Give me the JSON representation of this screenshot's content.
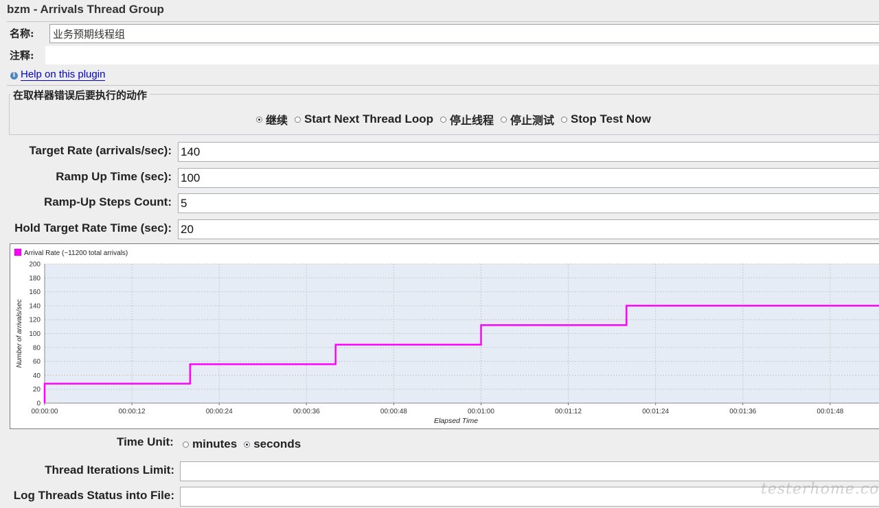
{
  "window": {
    "title": "bzm - Arrivals Thread Group"
  },
  "name_field": {
    "label": "名称:",
    "value": "业务预期线程组"
  },
  "comment_field": {
    "label": "注释:",
    "value": ""
  },
  "help": {
    "label": "Help on this plugin",
    "icon": "info-icon"
  },
  "sampler_error": {
    "title": "在取样器错误后要执行的动作",
    "options": [
      {
        "label": "继续",
        "checked": true
      },
      {
        "label": "Start Next Thread Loop",
        "checked": false
      },
      {
        "label": "停止线程",
        "checked": false
      },
      {
        "label": "停止测试",
        "checked": false
      },
      {
        "label": "Stop Test Now",
        "checked": false
      }
    ]
  },
  "params": {
    "target_rate": {
      "label": "Target Rate (arrivals/sec):",
      "value": "140"
    },
    "ramp_up_time": {
      "label": "Ramp Up Time (sec):",
      "value": "100"
    },
    "ramp_up_steps": {
      "label": "Ramp-Up Steps Count:",
      "value": "5"
    },
    "hold_time": {
      "label": "Hold Target Rate Time (sec):",
      "value": "20"
    }
  },
  "time_unit": {
    "label": "Time Unit:",
    "options": [
      {
        "label": "minutes",
        "checked": false
      },
      {
        "label": "seconds",
        "checked": true
      }
    ]
  },
  "thread_iterations": {
    "label": "Thread Iterations Limit:",
    "value": ""
  },
  "log_threads": {
    "label": "Log Threads Status into File:",
    "value": ""
  },
  "watermark": "testerhome.com",
  "chart_data": {
    "type": "line",
    "step": true,
    "series": [
      {
        "name": "Arrival Rate (~11200 total arrivals)",
        "color": "#ff00ff",
        "x": [
          0,
          20,
          20,
          40,
          40,
          60,
          60,
          80,
          80,
          120
        ],
        "y": [
          28,
          28,
          56,
          56,
          84,
          84,
          112,
          112,
          140,
          140
        ]
      }
    ],
    "xlabel": "Elapsed Time",
    "ylabel": "Number of arrivals/sec",
    "xlim": [
      0,
      115
    ],
    "ylim": [
      0,
      200
    ],
    "x_ticks": [
      0,
      12,
      24,
      36,
      48,
      60,
      72,
      84,
      96,
      108
    ],
    "x_tick_labels": [
      "00:00:00",
      "00:00:12",
      "00:00:24",
      "00:00:36",
      "00:00:48",
      "00:01:00",
      "00:01:12",
      "00:01:24",
      "00:01:36",
      "00:01:48"
    ],
    "y_ticks": [
      0,
      20,
      40,
      60,
      80,
      100,
      120,
      140,
      160,
      180,
      200
    ],
    "grid": true,
    "legend": "top-left",
    "plot_background": "#e6ecf5"
  }
}
